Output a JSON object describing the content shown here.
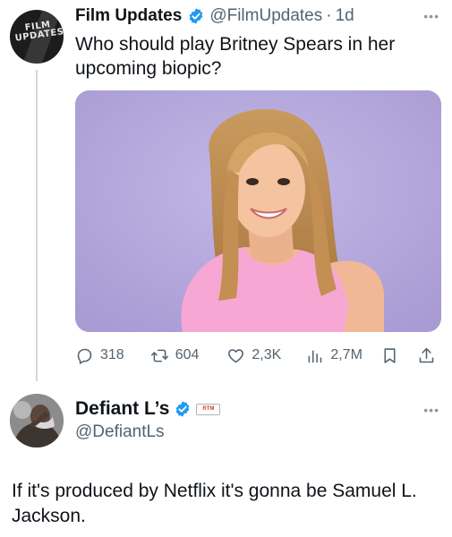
{
  "tweet1": {
    "name": "Film Updates",
    "handle": "@FilmUpdates",
    "separator": "·",
    "time": "1d",
    "text": "Who should play Britney Spears in her upcoming biopic?",
    "avatar_logo_line1": "FILM",
    "avatar_logo_line2": "UPDATES",
    "more": "•••",
    "actions": {
      "replies": "318",
      "reposts": "604",
      "likes": "2,3K",
      "views": "2,7M"
    }
  },
  "tweet2": {
    "name": "Defiant L’s",
    "handle": "@DefiantLs",
    "badge": "RTM",
    "more": "•••",
    "text": "If it's produced by Netflix it's gonna be Samuel L. Jackson."
  },
  "colors": {
    "verified_blue": "#1d9bf0",
    "secondary_text": "#536471",
    "photo_background": "#b8acdc"
  },
  "icons": [
    "reply-icon",
    "repost-icon",
    "like-icon",
    "views-icon",
    "bookmark-icon",
    "share-icon",
    "verified-badge-icon",
    "more-icon"
  ]
}
